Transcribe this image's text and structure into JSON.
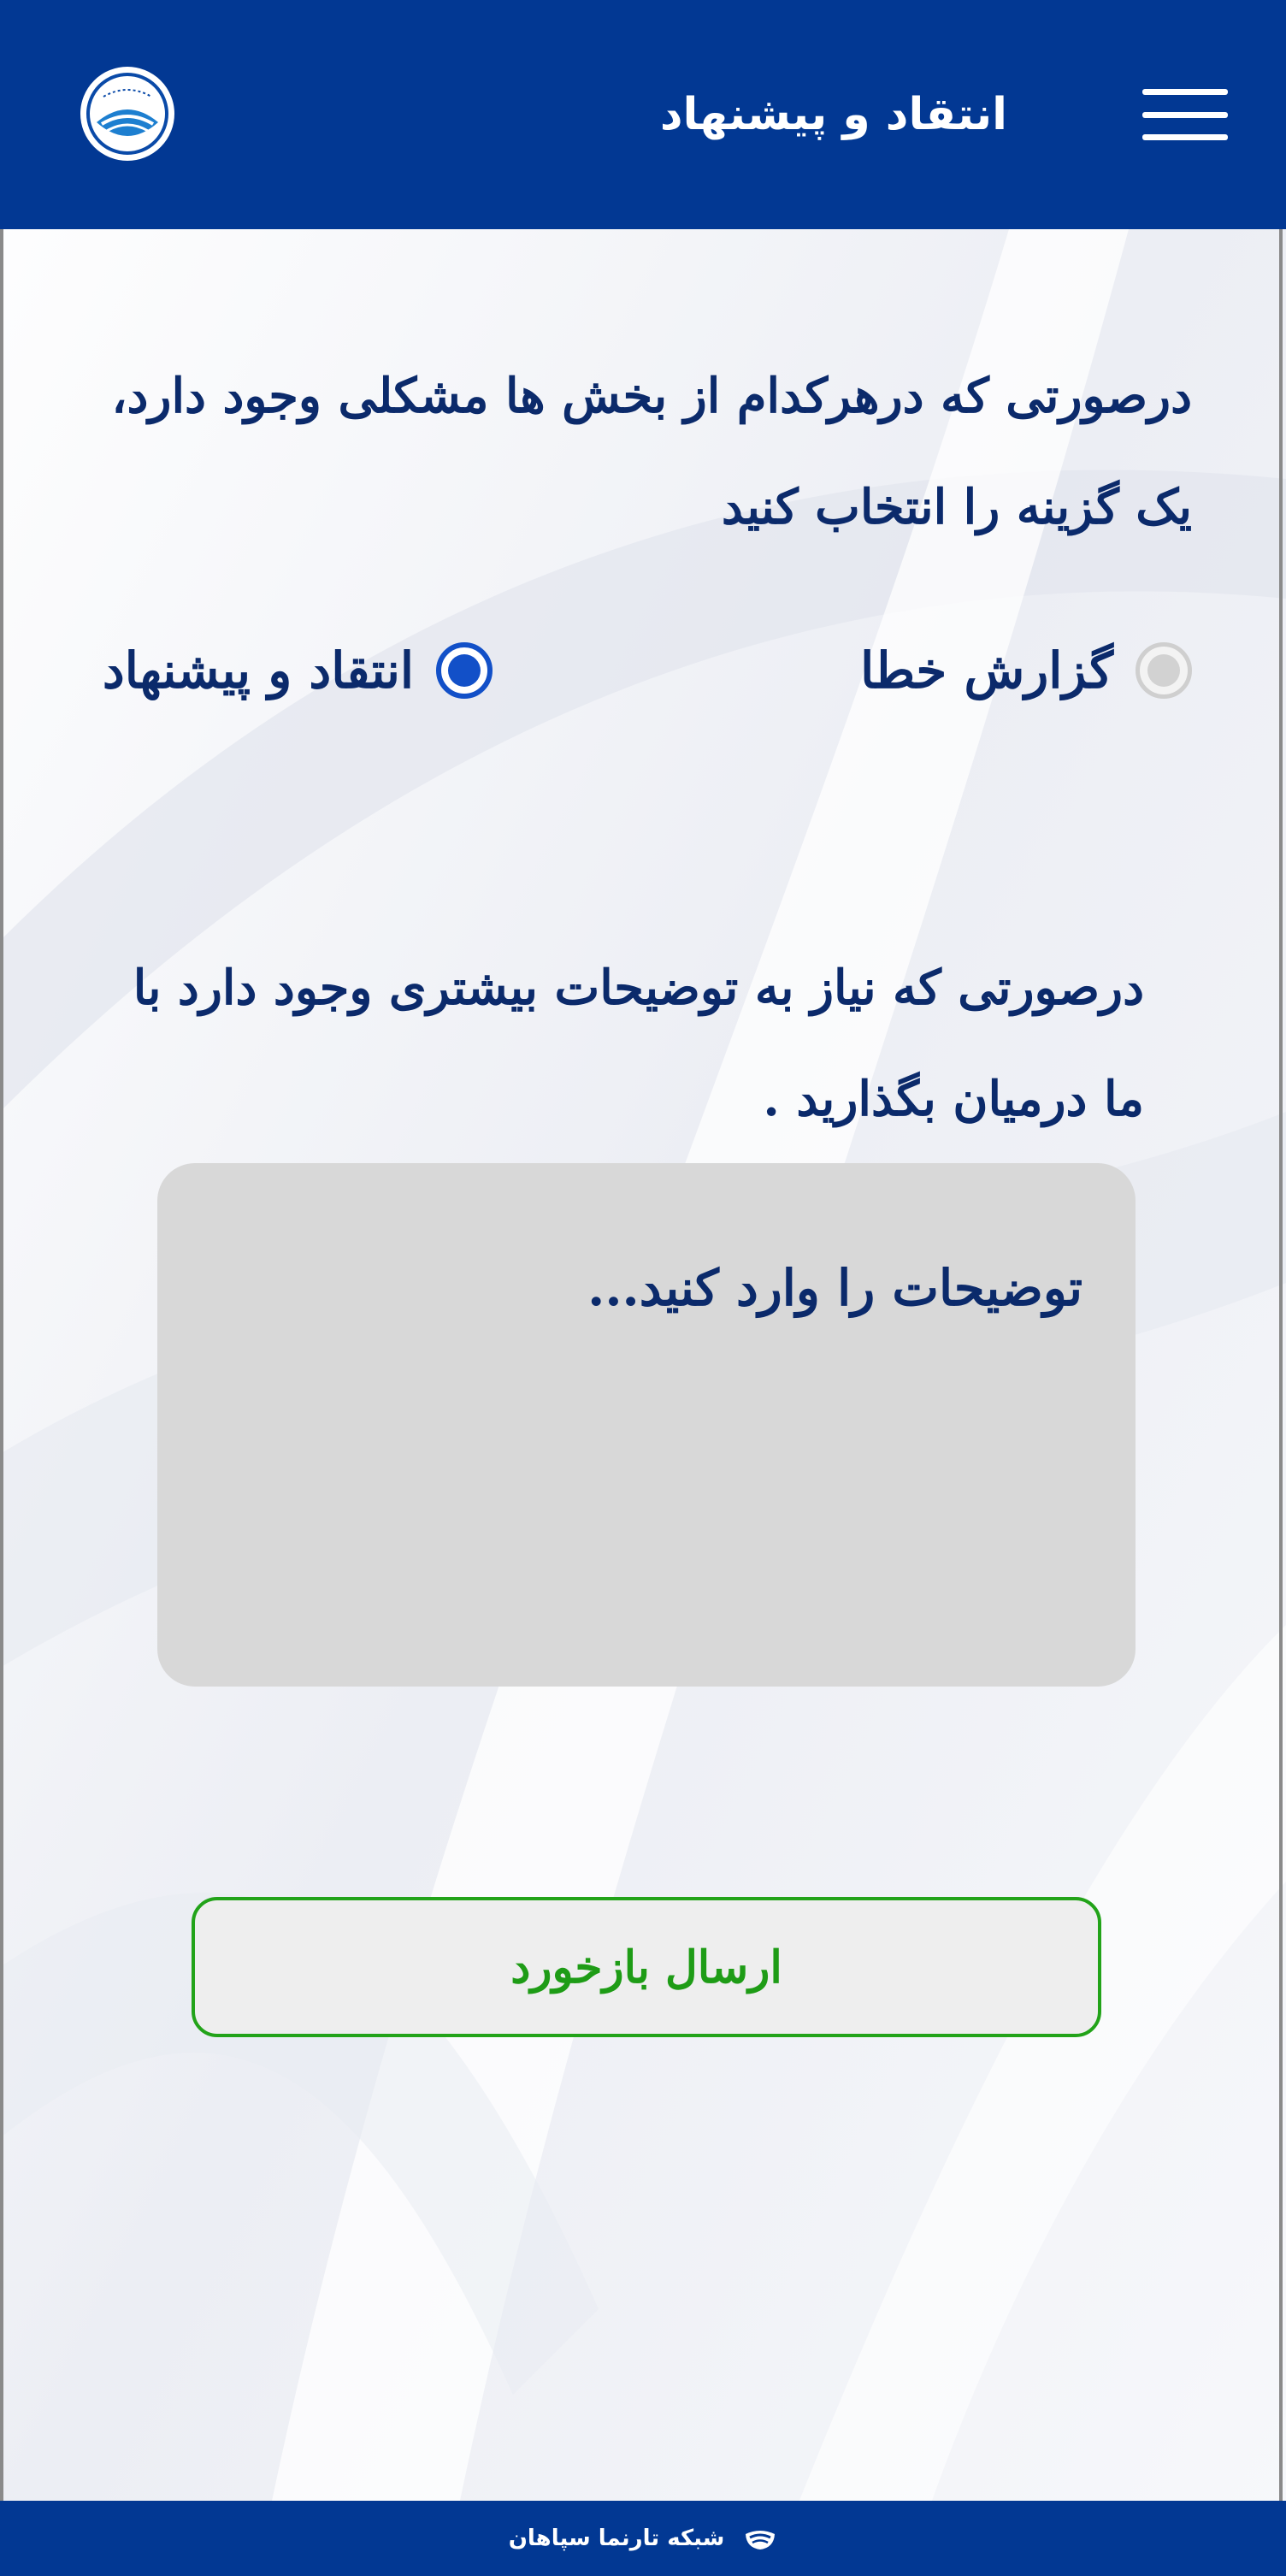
{
  "header": {
    "title": "انتقاد و پیشنهاد",
    "logo_icon": "water-company-logo-icon",
    "menu_icon": "hamburger-menu-icon"
  },
  "form": {
    "question": "درصورتی که درهرکدام از بخش ها مشکلی وجود دارد، یک گزینه را انتخاب کنید",
    "options": [
      {
        "label": "گزارش خطا",
        "selected": false
      },
      {
        "label": "انتقاد و پیشنهاد",
        "selected": true
      }
    ],
    "details_prompt": "درصورتی که نیاز به توضیحات بیشتری وجود دارد با ما درمیان بگذارید .",
    "details_placeholder": "توضیحات را وارد کنید...",
    "submit_label": "ارسال بازخورد"
  },
  "footer": {
    "text": "شبکه تارنما سپاهان",
    "logo_icon": "tarnama-logo-icon"
  },
  "colors": {
    "header_bg": "#023893",
    "text": "#0b2a6b",
    "radio_selected": "#1250c8",
    "submit": "#1e9c16",
    "textarea_bg": "#d8d8d8"
  }
}
